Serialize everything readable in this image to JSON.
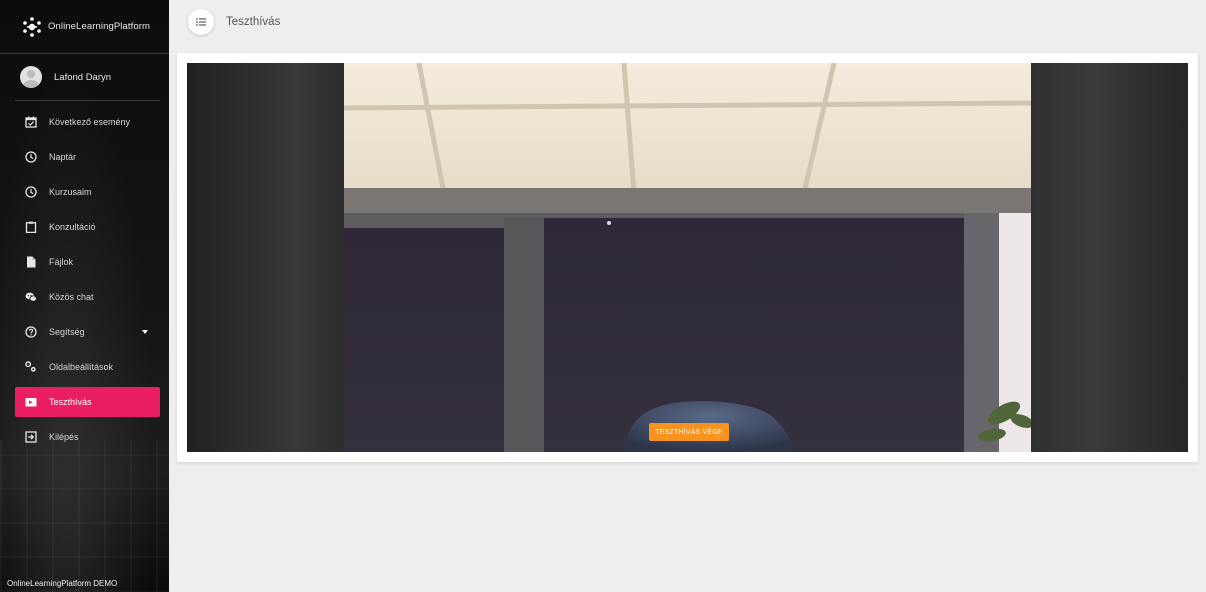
{
  "app": {
    "brand": "OnlineLearningPlatform",
    "footer": "OnlineLearningPlatform DEMO"
  },
  "user": {
    "name": "Lafond Daryn"
  },
  "nav": {
    "items": [
      {
        "label": "Következő esemény",
        "icon": "calendar-check-icon"
      },
      {
        "label": "Naptár",
        "icon": "clock-icon"
      },
      {
        "label": "Kurzusaim",
        "icon": "clock-icon"
      },
      {
        "label": "Konzultáció",
        "icon": "clipboard-icon"
      },
      {
        "label": "Fájlok",
        "icon": "file-icon"
      },
      {
        "label": "Közös chat",
        "icon": "chat-icon"
      },
      {
        "label": "Segítség",
        "icon": "help-icon"
      },
      {
        "label": "Oldalbeállítások",
        "icon": "settings-icon"
      },
      {
        "label": "Teszthívás",
        "icon": "video-call-icon",
        "active": true
      },
      {
        "label": "Kilépés",
        "icon": "logout-icon"
      }
    ]
  },
  "header": {
    "title": "Teszthívás"
  },
  "call": {
    "end_button": "TESZTHÍVÁS VÉGE"
  },
  "colors": {
    "accent": "#e91e63",
    "end_button": "#f7931e",
    "sidebar_bg": "#121212",
    "page_bg": "#eeeeee"
  }
}
